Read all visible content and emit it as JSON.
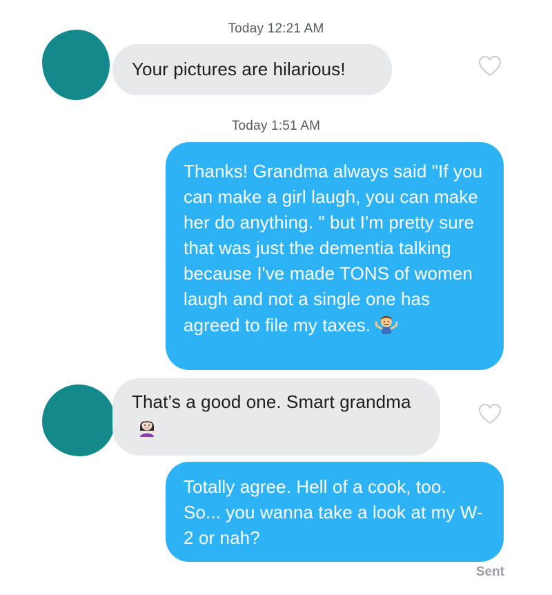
{
  "conversation": {
    "timestamps": [
      "Today 12:21 AM",
      "Today 1:51 AM"
    ],
    "messages": [
      {
        "direction": "incoming",
        "text": "Your pictures are hilarious!"
      },
      {
        "direction": "outgoing",
        "text": "Thanks! Grandma always said \"If you can make a girl laugh, you can make her do anything. \" but I'm pretty sure that was just the dementia talking because I've made TONS of women laugh and not a single one has agreed to file my taxes.",
        "emoji": "person-shrugging-emoji"
      },
      {
        "direction": "incoming",
        "text": "That’s a good one. Smart grandma",
        "emoji": "woman-tipping-hand-emoji"
      },
      {
        "direction": "outgoing",
        "text": "Totally agree. Hell of a cook, too. So... you wanna take a look at my W-2 or nah?"
      }
    ],
    "status": "Sent"
  },
  "colors": {
    "incoming_bubble": "#e8e9eb",
    "outgoing_bubble": "#2db3f5",
    "avatar": "#13898c",
    "timestamp": "#555a5e"
  },
  "icons": {
    "like": "heart-outline-icon"
  }
}
